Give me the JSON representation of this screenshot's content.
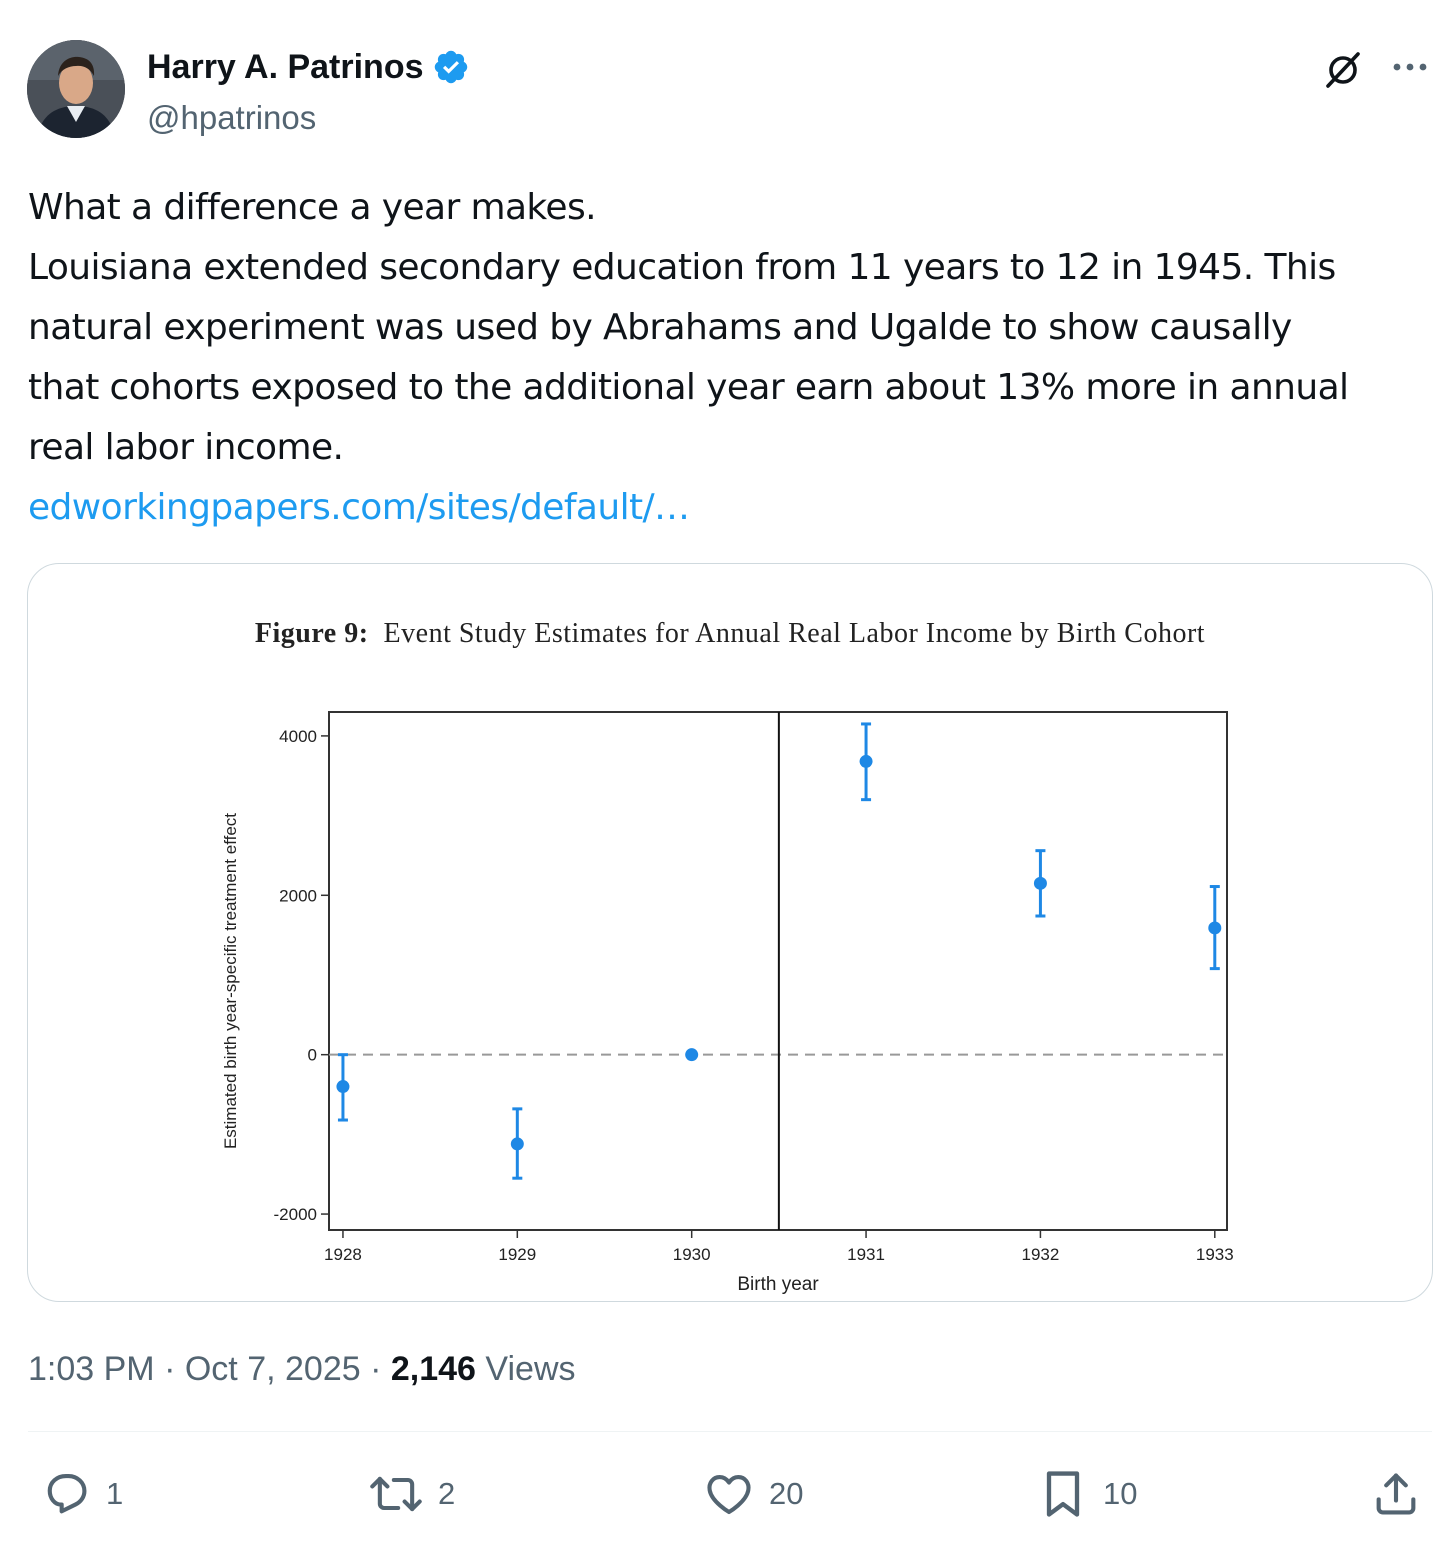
{
  "author": {
    "name": "Harry A. Patrinos",
    "handle": "@hpatrinos",
    "verified_color": "#1d9bf0"
  },
  "header_icons": [
    "grok-icon",
    "more-icon"
  ],
  "tweet": {
    "lines": [
      "What a difference a year makes.",
      "Louisiana extended secondary education from 11 years to 12 in 1945. This",
      "natural experiment was used by  Abrahams and Ugalde to show causally",
      "that cohorts exposed to the additional year earn about 13% more in annual",
      "real labor income."
    ],
    "link": "edworkingpapers.com/sites/default/…"
  },
  "figure": {
    "label": "Figure 9:",
    "title": "Event Study Estimates for Annual Real Labor Income by Birth Cohort"
  },
  "chart_data": {
    "type": "scatter",
    "title": "Figure 9: Event Study Estimates for Annual Real Labor Income by Birth Cohort",
    "xlabel": "Birth year",
    "ylabel": "Estimated birth year-specific treatment effect",
    "x": [
      1928,
      1929,
      1930,
      1931,
      1932,
      1933
    ],
    "y": [
      -400,
      -1120,
      0,
      3680,
      2150,
      1590
    ],
    "ci_low": [
      -820,
      -1550,
      0,
      3200,
      1740,
      1080
    ],
    "ci_high": [
      0,
      -680,
      0,
      4150,
      2560,
      2110
    ],
    "xticks": [
      "1928",
      "1929",
      "1930",
      "1931",
      "1932",
      "1933"
    ],
    "yticks": [
      "4000",
      "2000",
      "0",
      "-2000"
    ],
    "ytick_values": [
      4000,
      2000,
      0,
      -2000
    ],
    "xlim": [
      1927.92,
      1933.07
    ],
    "ylim": [
      -2200,
      4300
    ],
    "treatment_line_x": 1930.5,
    "reference_line_y": 0,
    "marker_color": "#1e88e5",
    "grid": false
  },
  "meta": {
    "time": "1:03 PM",
    "date": "Oct 7, 2025",
    "sep": "·",
    "views_count": "2,146",
    "views_label": "Views"
  },
  "actions": {
    "replies": "1",
    "reposts": "2",
    "likes": "20",
    "bookmarks": "10"
  }
}
